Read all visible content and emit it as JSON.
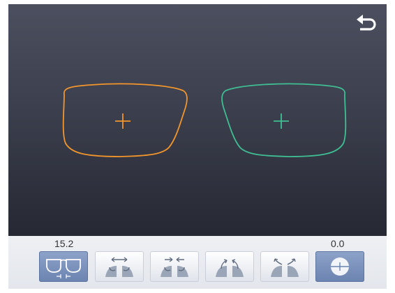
{
  "screen": {
    "back_icon": "return-arrow-icon",
    "left_lens": {
      "color": "#f3962b",
      "marker": "crosshair"
    },
    "right_lens": {
      "color": "#3fbf93",
      "marker": "crosshair"
    }
  },
  "toolbar": {
    "left_value": "15.2",
    "right_value": "0.0",
    "buttons": [
      {
        "icon": "glasses-icon",
        "active": true
      },
      {
        "icon": "widen-icon",
        "active": false
      },
      {
        "icon": "narrow-icon",
        "active": false
      },
      {
        "icon": "tilt-in-icon",
        "active": false
      },
      {
        "icon": "tilt-out-icon",
        "active": false
      },
      {
        "icon": "center-line-icon",
        "active": true
      }
    ]
  }
}
